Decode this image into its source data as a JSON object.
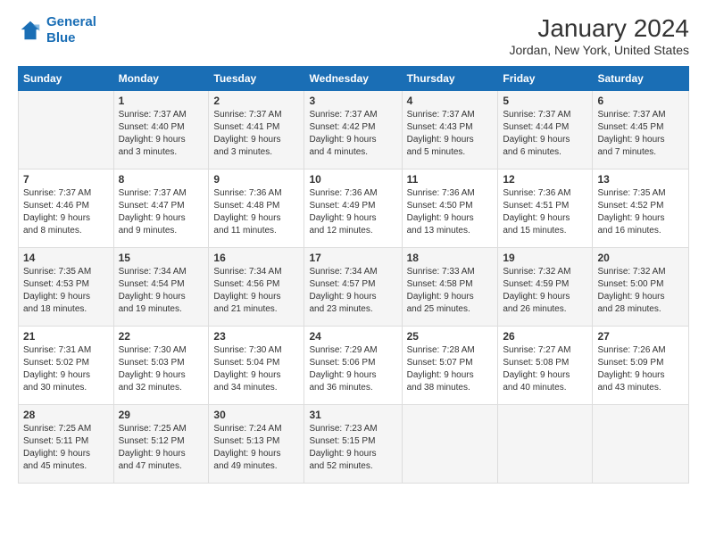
{
  "header": {
    "logo_line1": "General",
    "logo_line2": "Blue",
    "main_title": "January 2024",
    "subtitle": "Jordan, New York, United States"
  },
  "columns": [
    "Sunday",
    "Monday",
    "Tuesday",
    "Wednesday",
    "Thursday",
    "Friday",
    "Saturday"
  ],
  "weeks": [
    [
      {
        "day": "",
        "lines": []
      },
      {
        "day": "1",
        "lines": [
          "Sunrise: 7:37 AM",
          "Sunset: 4:40 PM",
          "Daylight: 9 hours",
          "and 3 minutes."
        ]
      },
      {
        "day": "2",
        "lines": [
          "Sunrise: 7:37 AM",
          "Sunset: 4:41 PM",
          "Daylight: 9 hours",
          "and 3 minutes."
        ]
      },
      {
        "day": "3",
        "lines": [
          "Sunrise: 7:37 AM",
          "Sunset: 4:42 PM",
          "Daylight: 9 hours",
          "and 4 minutes."
        ]
      },
      {
        "day": "4",
        "lines": [
          "Sunrise: 7:37 AM",
          "Sunset: 4:43 PM",
          "Daylight: 9 hours",
          "and 5 minutes."
        ]
      },
      {
        "day": "5",
        "lines": [
          "Sunrise: 7:37 AM",
          "Sunset: 4:44 PM",
          "Daylight: 9 hours",
          "and 6 minutes."
        ]
      },
      {
        "day": "6",
        "lines": [
          "Sunrise: 7:37 AM",
          "Sunset: 4:45 PM",
          "Daylight: 9 hours",
          "and 7 minutes."
        ]
      }
    ],
    [
      {
        "day": "7",
        "lines": [
          "Sunrise: 7:37 AM",
          "Sunset: 4:46 PM",
          "Daylight: 9 hours",
          "and 8 minutes."
        ]
      },
      {
        "day": "8",
        "lines": [
          "Sunrise: 7:37 AM",
          "Sunset: 4:47 PM",
          "Daylight: 9 hours",
          "and 9 minutes."
        ]
      },
      {
        "day": "9",
        "lines": [
          "Sunrise: 7:36 AM",
          "Sunset: 4:48 PM",
          "Daylight: 9 hours",
          "and 11 minutes."
        ]
      },
      {
        "day": "10",
        "lines": [
          "Sunrise: 7:36 AM",
          "Sunset: 4:49 PM",
          "Daylight: 9 hours",
          "and 12 minutes."
        ]
      },
      {
        "day": "11",
        "lines": [
          "Sunrise: 7:36 AM",
          "Sunset: 4:50 PM",
          "Daylight: 9 hours",
          "and 13 minutes."
        ]
      },
      {
        "day": "12",
        "lines": [
          "Sunrise: 7:36 AM",
          "Sunset: 4:51 PM",
          "Daylight: 9 hours",
          "and 15 minutes."
        ]
      },
      {
        "day": "13",
        "lines": [
          "Sunrise: 7:35 AM",
          "Sunset: 4:52 PM",
          "Daylight: 9 hours",
          "and 16 minutes."
        ]
      }
    ],
    [
      {
        "day": "14",
        "lines": [
          "Sunrise: 7:35 AM",
          "Sunset: 4:53 PM",
          "Daylight: 9 hours",
          "and 18 minutes."
        ]
      },
      {
        "day": "15",
        "lines": [
          "Sunrise: 7:34 AM",
          "Sunset: 4:54 PM",
          "Daylight: 9 hours",
          "and 19 minutes."
        ]
      },
      {
        "day": "16",
        "lines": [
          "Sunrise: 7:34 AM",
          "Sunset: 4:56 PM",
          "Daylight: 9 hours",
          "and 21 minutes."
        ]
      },
      {
        "day": "17",
        "lines": [
          "Sunrise: 7:34 AM",
          "Sunset: 4:57 PM",
          "Daylight: 9 hours",
          "and 23 minutes."
        ]
      },
      {
        "day": "18",
        "lines": [
          "Sunrise: 7:33 AM",
          "Sunset: 4:58 PM",
          "Daylight: 9 hours",
          "and 25 minutes."
        ]
      },
      {
        "day": "19",
        "lines": [
          "Sunrise: 7:32 AM",
          "Sunset: 4:59 PM",
          "Daylight: 9 hours",
          "and 26 minutes."
        ]
      },
      {
        "day": "20",
        "lines": [
          "Sunrise: 7:32 AM",
          "Sunset: 5:00 PM",
          "Daylight: 9 hours",
          "and 28 minutes."
        ]
      }
    ],
    [
      {
        "day": "21",
        "lines": [
          "Sunrise: 7:31 AM",
          "Sunset: 5:02 PM",
          "Daylight: 9 hours",
          "and 30 minutes."
        ]
      },
      {
        "day": "22",
        "lines": [
          "Sunrise: 7:30 AM",
          "Sunset: 5:03 PM",
          "Daylight: 9 hours",
          "and 32 minutes."
        ]
      },
      {
        "day": "23",
        "lines": [
          "Sunrise: 7:30 AM",
          "Sunset: 5:04 PM",
          "Daylight: 9 hours",
          "and 34 minutes."
        ]
      },
      {
        "day": "24",
        "lines": [
          "Sunrise: 7:29 AM",
          "Sunset: 5:06 PM",
          "Daylight: 9 hours",
          "and 36 minutes."
        ]
      },
      {
        "day": "25",
        "lines": [
          "Sunrise: 7:28 AM",
          "Sunset: 5:07 PM",
          "Daylight: 9 hours",
          "and 38 minutes."
        ]
      },
      {
        "day": "26",
        "lines": [
          "Sunrise: 7:27 AM",
          "Sunset: 5:08 PM",
          "Daylight: 9 hours",
          "and 40 minutes."
        ]
      },
      {
        "day": "27",
        "lines": [
          "Sunrise: 7:26 AM",
          "Sunset: 5:09 PM",
          "Daylight: 9 hours",
          "and 43 minutes."
        ]
      }
    ],
    [
      {
        "day": "28",
        "lines": [
          "Sunrise: 7:25 AM",
          "Sunset: 5:11 PM",
          "Daylight: 9 hours",
          "and 45 minutes."
        ]
      },
      {
        "day": "29",
        "lines": [
          "Sunrise: 7:25 AM",
          "Sunset: 5:12 PM",
          "Daylight: 9 hours",
          "and 47 minutes."
        ]
      },
      {
        "day": "30",
        "lines": [
          "Sunrise: 7:24 AM",
          "Sunset: 5:13 PM",
          "Daylight: 9 hours",
          "and 49 minutes."
        ]
      },
      {
        "day": "31",
        "lines": [
          "Sunrise: 7:23 AM",
          "Sunset: 5:15 PM",
          "Daylight: 9 hours",
          "and 52 minutes."
        ]
      },
      {
        "day": "",
        "lines": []
      },
      {
        "day": "",
        "lines": []
      },
      {
        "day": "",
        "lines": []
      }
    ]
  ]
}
